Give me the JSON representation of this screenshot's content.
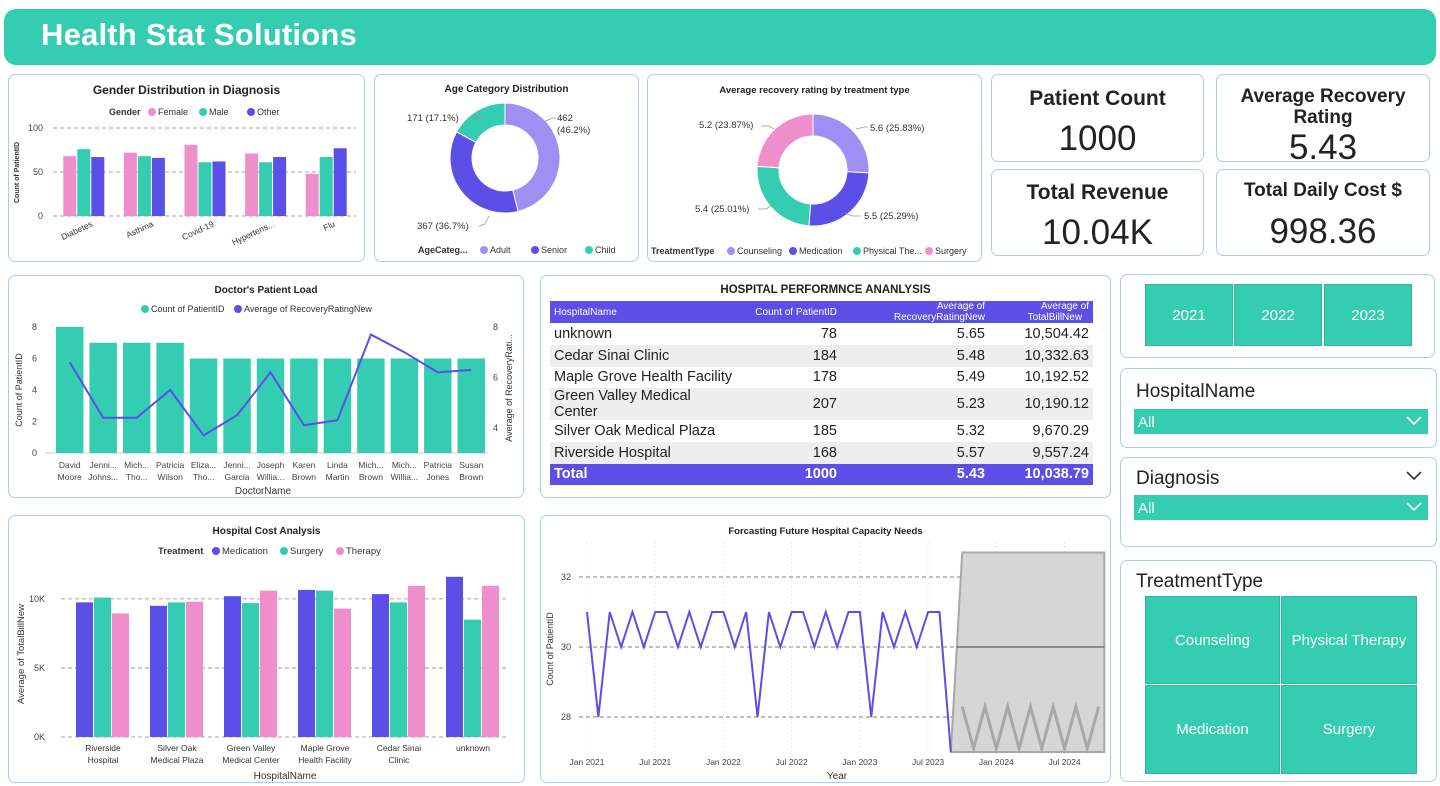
{
  "header": {
    "title": "Health Stat  Solutions"
  },
  "gender": {
    "title": "Gender Distribution in Diagnosis",
    "legend_title": "Gender",
    "series_labels": [
      "Female",
      "Male",
      "Other"
    ],
    "ylabel": "Count of PatientID",
    "yticks": [
      "100",
      "50",
      "0"
    ],
    "categories": [
      "Diabetes",
      "Asthma",
      "Covid-19",
      "Hypertens...",
      "Flu"
    ]
  },
  "age": {
    "title": "Age Category Distribution",
    "labels": {
      "adult": "462\n(46.2%)",
      "senior": "367 (36.7%)",
      "child": "171 (17.1%)"
    },
    "legend_title": "AgeCateg...",
    "legend": [
      "Adult",
      "Senior",
      "Child"
    ]
  },
  "recovery": {
    "title": "Average recovery rating by treatment type",
    "labels": [
      "5.6 (25.83%)",
      "5.5 (25.29%)",
      "5.4 (25.01%)",
      "5.2 (23.87%)"
    ],
    "legend_title": "TreatmentType",
    "legend": [
      "Counseling",
      "Medication",
      "Physical The...",
      "Surgery"
    ]
  },
  "kpis": {
    "patient_count_label": "Patient Count",
    "patient_count_value": "1000",
    "avg_recovery_label": "Average Recovery Rating",
    "avg_recovery_value": "5.43",
    "revenue_label": "Total Revenue",
    "revenue_value": "10.04K",
    "daily_cost_label": "Total Daily Cost $",
    "daily_cost_value": "998.36"
  },
  "doctor": {
    "title": "Doctor's Patient Load",
    "legend": [
      "Count of PatientID",
      "Average of RecoveryRatingNew"
    ],
    "ylabel_left": "Count of PatientID",
    "ylabel_right": "Average of RecoveryRati...",
    "xlabel": "DoctorName",
    "yticks_left": [
      "8",
      "6",
      "4",
      "2",
      "0"
    ],
    "yticks_right": [
      "8",
      "6",
      "4"
    ],
    "doctors": [
      [
        "David",
        "Moore"
      ],
      [
        "Jenni...",
        "Johns..."
      ],
      [
        "Mich...",
        "Tho..."
      ],
      [
        "Patricia",
        "Wilson"
      ],
      [
        "Eliza...",
        "Tho..."
      ],
      [
        "Jenni...",
        "Garcia"
      ],
      [
        "Joseph",
        "Willia..."
      ],
      [
        "Karen",
        "Brown"
      ],
      [
        "Linda",
        "Martin"
      ],
      [
        "Mich...",
        "Brown"
      ],
      [
        "Mich...",
        "Willia..."
      ],
      [
        "Patricia",
        "Jones"
      ],
      [
        "Susan",
        "Brown"
      ]
    ]
  },
  "performance": {
    "title": "HOSPITAL PERFORMNCE ANANLYSIS",
    "columns": [
      "HospitalName",
      "Count of PatientID",
      "Average of RecoveryRatingNew",
      "Average of TotalBillNew"
    ],
    "rows": [
      {
        "name": "unknown",
        "count": "78",
        "rating": "5.65",
        "bill": "10,504.42"
      },
      {
        "name": "Cedar Sinai Clinic",
        "count": "184",
        "rating": "5.48",
        "bill": "10,332.63"
      },
      {
        "name": "Maple Grove Health Facility",
        "count": "178",
        "rating": "5.49",
        "bill": "10,192.52"
      },
      {
        "name": "Green Valley Medical Center",
        "count": "207",
        "rating": "5.23",
        "bill": "10,190.12"
      },
      {
        "name": "Silver Oak Medical Plaza",
        "count": "185",
        "rating": "5.32",
        "bill": "9,670.29"
      },
      {
        "name": "Riverside Hospital",
        "count": "168",
        "rating": "5.57",
        "bill": "9,557.24"
      }
    ],
    "total": {
      "name": "Total",
      "count": "1000",
      "rating": "5.43",
      "bill": "10,038.79"
    }
  },
  "years": [
    "2021",
    "2022",
    "2023"
  ],
  "hospital_slicer": {
    "label": "HospitalName",
    "value": "All"
  },
  "diagnosis_slicer": {
    "label": "Diagnosis",
    "value": "All"
  },
  "treatment_slicer": {
    "label": "TreatmentType",
    "options": [
      "Counseling",
      "Physical Therapy",
      "Medication",
      "Surgery"
    ]
  },
  "cost": {
    "title": "Hospital Cost Analysis",
    "legend_title": "Treatment",
    "series_labels": [
      "Medication",
      "Surgery",
      "Therapy"
    ],
    "ylabel": "Average of TotalBillNew",
    "xlabel": "HospitalName",
    "yticks": [
      "10K",
      "5K",
      "0K"
    ],
    "hospitals": [
      [
        "Riverside",
        "Hospital"
      ],
      [
        "Silver Oak",
        "Medical Plaza"
      ],
      [
        "Green Valley",
        "Medical Center"
      ],
      [
        "Maple Grove",
        "Health Facility"
      ],
      [
        "Cedar Sinai",
        "Clinic"
      ],
      [
        "unknown",
        ""
      ]
    ]
  },
  "forecast": {
    "title": "Forcasting Future Hospital Capacity Needs",
    "ylabel": "Count of PatientID",
    "xlabel": "Year",
    "yticks": [
      "32",
      "30",
      "28"
    ],
    "xticks": [
      "Jan 2021",
      "Jul 2021",
      "Jan 2022",
      "Jul 2022",
      "Jan 2023",
      "Jul 2023",
      "Jan 2024",
      "Jul 2024"
    ]
  },
  "colors": {
    "teal": "#34cdb1",
    "purple": "#5b4fe8",
    "pink": "#ee8fcb",
    "lavender": "#9f8ff2",
    "gray": "#d6d6d6"
  },
  "chart_data": [
    {
      "type": "bar",
      "title": "Gender Distribution in Diagnosis",
      "categories": [
        "Diabetes",
        "Asthma",
        "Covid-19",
        "Hypertens...",
        "Flu"
      ],
      "ylabel": "Count of PatientID",
      "ylim": [
        0,
        100
      ],
      "series": [
        {
          "name": "Female",
          "values": [
            68,
            72,
            81,
            71,
            48
          ]
        },
        {
          "name": "Male",
          "values": [
            76,
            68,
            61,
            61,
            67
          ]
        },
        {
          "name": "Other",
          "values": [
            67,
            66,
            62,
            67,
            77
          ]
        }
      ]
    },
    {
      "type": "pie",
      "title": "Age Category Distribution",
      "categories": [
        "Adult",
        "Senior",
        "Child"
      ],
      "values": [
        462,
        367,
        171
      ]
    },
    {
      "type": "pie",
      "title": "Average recovery rating by treatment type",
      "categories": [
        "Counseling",
        "Medication",
        "Physical Therapy",
        "Surgery"
      ],
      "values": [
        5.6,
        5.5,
        5.4,
        5.2
      ]
    },
    {
      "type": "bar",
      "title": "Doctor's Patient Load",
      "categories": [
        "David Moore",
        "Jenni... Johns...",
        "Mich... Tho...",
        "Patricia Wilson",
        "Eliza... Tho...",
        "Jenni... Garcia",
        "Joseph Willia...",
        "Karen Brown",
        "Linda Martin",
        "Mich... Brown",
        "Mich... Willia...",
        "Patricia Jones",
        "Susan Brown"
      ],
      "xlabel": "DoctorName",
      "series": [
        {
          "name": "Count of PatientID",
          "values": [
            8,
            7,
            7,
            7,
            6,
            6,
            6,
            6,
            6,
            6,
            6,
            6,
            6
          ],
          "ylim": [
            0,
            8
          ]
        },
        {
          "name": "Average of RecoveryRatingNew",
          "values": [
            6.6,
            4.4,
            4.4,
            5.5,
            3.7,
            4.5,
            6.2,
            4.1,
            4.3,
            7.7,
            7.0,
            6.2,
            6.3
          ],
          "ylim": [
            3,
            8
          ],
          "type": "line"
        }
      ]
    },
    {
      "type": "bar",
      "title": "Hospital Cost Analysis",
      "categories": [
        "Riverside Hospital",
        "Silver Oak Medical Plaza",
        "Green Valley Medical Center",
        "Maple Grove Health Facility",
        "Cedar Sinai Clinic",
        "unknown"
      ],
      "xlabel": "HospitalName",
      "ylabel": "Average of TotalBillNew",
      "ylim": [
        0,
        12600
      ],
      "series": [
        {
          "name": "Medication",
          "values": [
            9750,
            9500,
            10200,
            10650,
            10350,
            11600
          ]
        },
        {
          "name": "Surgery",
          "values": [
            10100,
            9750,
            9700,
            10600,
            9750,
            8500
          ]
        },
        {
          "name": "Therapy",
          "values": [
            8950,
            9800,
            10600,
            9300,
            10950,
            10950
          ]
        }
      ]
    },
    {
      "type": "line",
      "title": "Forcasting Future Hospital Capacity Needs",
      "xlabel": "Year",
      "ylabel": "Count of PatientID",
      "ylim": [
        27,
        33
      ],
      "series": [
        {
          "name": "Count of PatientID",
          "x": [
            "2021-01",
            "2021-02",
            "2021-03",
            "2021-04",
            "2021-05",
            "2021-06",
            "2021-07",
            "2021-08",
            "2021-09",
            "2021-10",
            "2021-11",
            "2021-12",
            "2022-01",
            "2022-02",
            "2022-03",
            "2022-04",
            "2022-05",
            "2022-06",
            "2022-07",
            "2022-08",
            "2022-09",
            "2022-10",
            "2022-11",
            "2022-12",
            "2023-01",
            "2023-02",
            "2023-03",
            "2023-04",
            "2023-05",
            "2023-06",
            "2023-07",
            "2023-08",
            "2023-09"
          ],
          "values": [
            31,
            28,
            31,
            30,
            31,
            30,
            31,
            31,
            30,
            31,
            30,
            31,
            31,
            30,
            31,
            28,
            31,
            30,
            31,
            31,
            30,
            31,
            30,
            31,
            31,
            28,
            31,
            30,
            31,
            30,
            31,
            31,
            27
          ]
        },
        {
          "name": "Forecast",
          "x": [
            "2023-10",
            "2024-10"
          ],
          "values": [
            30,
            30
          ]
        }
      ]
    }
  ]
}
